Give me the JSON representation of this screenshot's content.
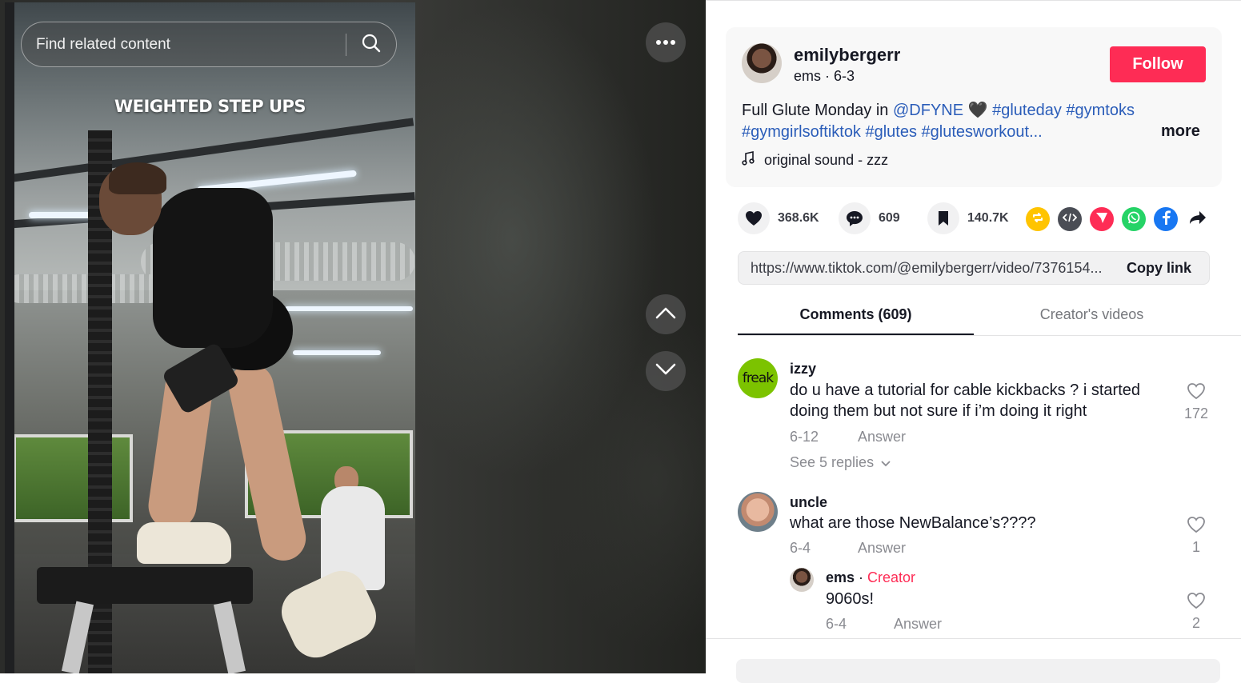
{
  "video": {
    "overlay_text": "WEIGHTED STEP UPS",
    "search": {
      "placeholder": "Find related content"
    },
    "icons": {
      "search": "search-icon",
      "more": "more-dots-icon",
      "up": "chevron-up-icon",
      "down": "chevron-down-icon"
    }
  },
  "post": {
    "username": "emilybergerr",
    "nickname": "ems",
    "date": "6-3",
    "subline_separator": " · ",
    "follow_label": "Follow",
    "description": {
      "text": "Full Glute Monday in ",
      "mention": "@DFYNE",
      "emoji": " 🖤",
      "hashtags_line1": "#gluteday #gymtoks",
      "hashtags_line2": "#gymgirlsoftiktok #glutes #gluteswork­out..."
    },
    "more_label": "more",
    "sound": "original sound - zzz"
  },
  "actions": {
    "likes": "368.6K",
    "comments": "609",
    "saves": "140.7K",
    "share_targets": [
      "repost",
      "embed",
      "send",
      "whatsapp",
      "facebook",
      "share"
    ]
  },
  "copy_link": {
    "url": "https://www.tiktok.com/@emilybergerr/video/7376154...",
    "button": "Copy link"
  },
  "tabs": {
    "comments_label": "Comments (609)",
    "creator_videos_label": "Creator's videos"
  },
  "comments": [
    {
      "user": "izzy",
      "avatar_text": "freak",
      "text": "do u have a tutorial for cable kickbacks ? i started doing them but not sure if i’m doing it right",
      "date": "6-12",
      "answer": "Answer",
      "likes": "172",
      "see_replies": "See 5 replies"
    },
    {
      "user": "uncle",
      "text": "what are those NewBalance’s????",
      "date": "6-4",
      "answer": "Answer",
      "likes": "1",
      "reply": {
        "user": "ems",
        "separator": " · ",
        "creator_label": "Creator",
        "text": "9060s!",
        "date": "6-4",
        "answer": "Answer",
        "likes": "2"
      }
    }
  ],
  "colors": {
    "accent": "#fe2c55",
    "link": "#2b5db9",
    "repost": "#ffc400",
    "whatsapp": "#25d366",
    "facebook": "#1877f2",
    "avatar_green": "#7cc300"
  }
}
